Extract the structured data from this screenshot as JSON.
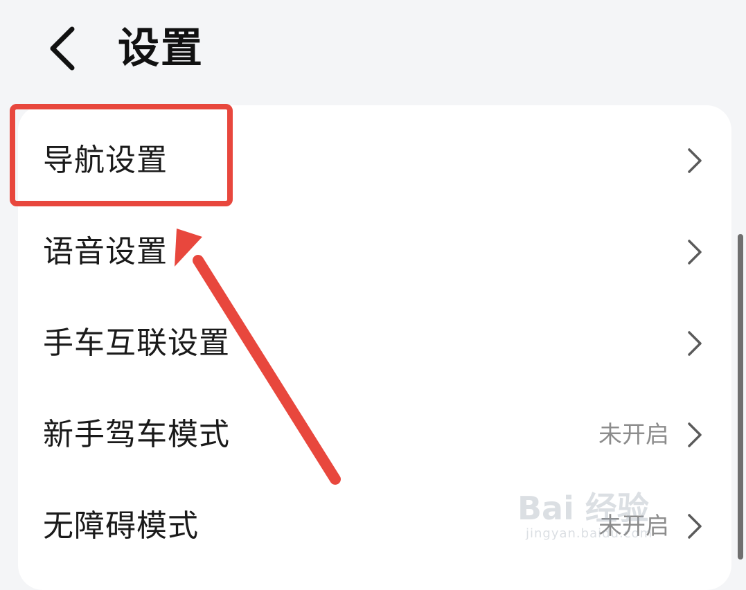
{
  "header": {
    "title": "设置",
    "back_icon": "chevron-left-icon"
  },
  "settings": {
    "items": [
      {
        "label": "导航设置",
        "value": ""
      },
      {
        "label": "语音设置",
        "value": ""
      },
      {
        "label": "手车互联设置",
        "value": ""
      },
      {
        "label": "新手驾车模式",
        "value": "未开启"
      },
      {
        "label": "无障碍模式",
        "value": "未开启"
      }
    ]
  },
  "annotation": {
    "color": "#e8473d"
  },
  "watermark": {
    "main": "Bai 经验",
    "sub": "jingyan.baidu.com"
  },
  "colors": {
    "background": "#f4f5f7",
    "card": "#ffffff",
    "text_primary": "#1a1a1a",
    "text_secondary": "#8c8c8c"
  }
}
